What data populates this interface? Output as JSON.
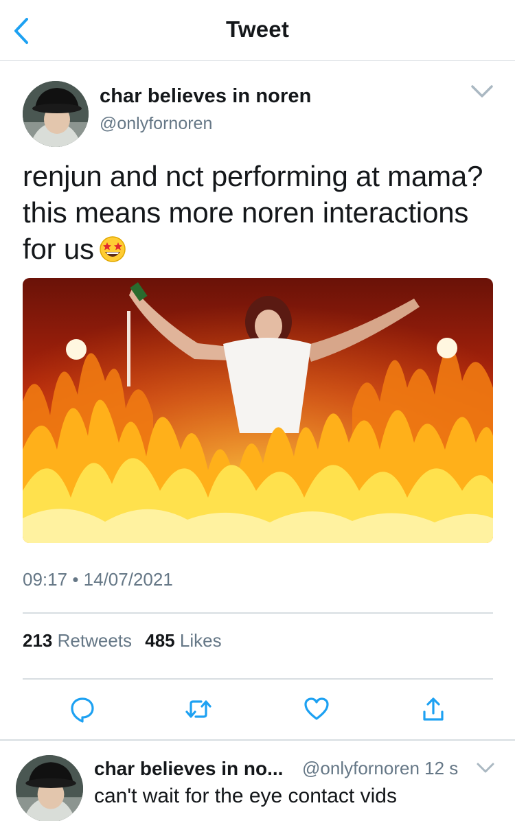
{
  "nav": {
    "title": "Tweet",
    "back_icon": "chevron-left-icon",
    "accent": "#1da1f2"
  },
  "tweet": {
    "author_name": "char believes in noren",
    "author_handle": "@onlyfornoren",
    "text_line1": "renjun and nct performing at mama?",
    "text_line2": "this means more noren interactions",
    "text_line3": "for us",
    "emoji": "star-struck-emoji",
    "time": "09:17",
    "dot": "•",
    "date": "14/07/2021",
    "retweets_count": "213",
    "retweets_label": "Retweets",
    "likes_count": "485",
    "likes_label": "Likes"
  },
  "actions": {
    "reply_icon": "reply-icon",
    "retweet_icon": "retweet-icon",
    "like_icon": "heart-icon",
    "share_icon": "share-icon"
  },
  "reply": {
    "author_name": "char believes in no...",
    "handle_time": "@onlyfornoren 12 s",
    "text": "can't wait for the eye contact vids"
  },
  "colors": {
    "text": "#14171a",
    "secondary": "#657786",
    "divider": "#d7dde1",
    "accent": "#1da1f2"
  }
}
